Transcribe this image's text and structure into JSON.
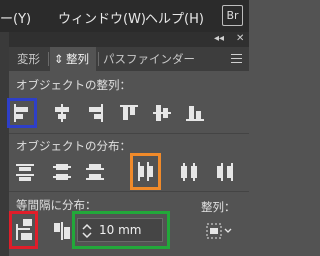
{
  "menubar": {
    "items": [
      "ー(Y)",
      "ウィンドウ(W)",
      "ヘルプ(H)"
    ],
    "app_badge": "Br"
  },
  "panel": {
    "tabs": [
      {
        "label": "変形"
      },
      {
        "label": "整列",
        "active": true,
        "prefix": "⇕"
      },
      {
        "label": "パスファインダー"
      }
    ],
    "align_objects": {
      "title": "オブジェクトの整列：",
      "buttons": [
        "align-left",
        "align-horizontal-center",
        "align-right",
        "align-top",
        "align-vertical-center",
        "align-bottom"
      ]
    },
    "distribute_objects": {
      "title": "オブジェクトの分布：",
      "buttons": [
        "distribute-top",
        "distribute-vertical-center",
        "distribute-bottom",
        "distribute-left",
        "distribute-horizontal-center",
        "distribute-right"
      ]
    },
    "distribute_spacing": {
      "title": "等間隔に分布：",
      "value": "10 mm",
      "align_to_title": "整列："
    }
  },
  "highlight_colors": {
    "blue": "#2e3fc8",
    "orange": "#f08a2a",
    "red": "#e01e2a",
    "green": "#22a83a"
  }
}
